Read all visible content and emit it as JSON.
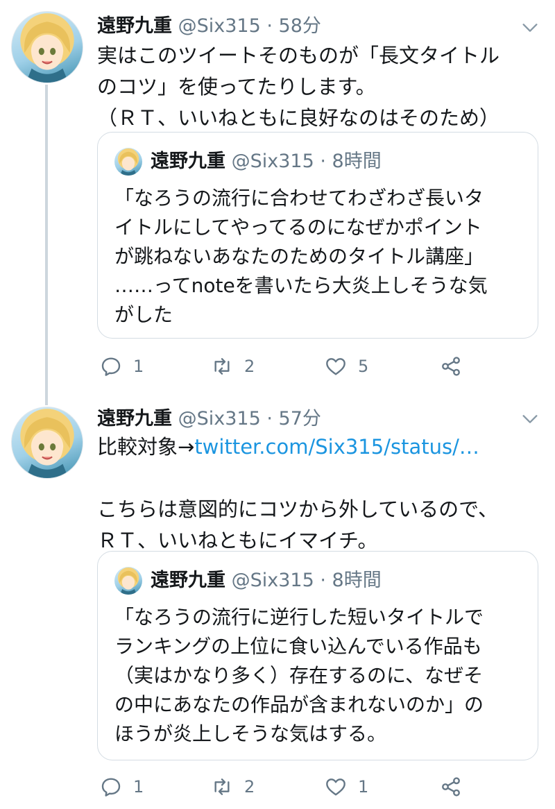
{
  "tweets": [
    {
      "name": "遠野九重",
      "handle": "@Six315",
      "sep": "·",
      "time": "58分",
      "text": "実はこのツイートそのものが「長文タイトル\nのコツ」を使ってたりします。\n（ＲＴ、いいねともに良好なのはそのため）",
      "quote": {
        "name": "遠野九重",
        "handle": "@Six315",
        "sep": "·",
        "time": "8時間",
        "text": "「なろうの流行に合わせてわざわざ長いタ\nイトルにしてやってるのになぜかポイント\nが跳ねないあなたのためのタイトル講座」\n……ってnoteを書いたら大炎上しそうな気\nがした"
      },
      "replies": "1",
      "retweets": "2",
      "likes": "5"
    },
    {
      "name": "遠野九重",
      "handle": "@Six315",
      "sep": "·",
      "time": "57分",
      "text_prefix": "比較対象→",
      "link": "twitter.com/Six315/status/…",
      "text": "\nこちらは意図的にコツから外しているので、\nＲＴ、いいねともにイマイチ。",
      "quote": {
        "name": "遠野九重",
        "handle": "@Six315",
        "sep": "·",
        "time": "8時間",
        "text": "「なろうの流行に逆行した短いタイトルで\nランキングの上位に食い込んでいる作品も\n（実はかなり多く）存在するのに、なぜそ\nの中にあなたの作品が含まれないのか」の\nほうが炎上しそうな気はする。"
      },
      "replies": "1",
      "retweets": "2",
      "likes": "1"
    }
  ],
  "colors": {
    "link": "#1b95e0",
    "muted": "#657786",
    "border": "#d4dce3",
    "thread": "#cdd6dd"
  },
  "icons": [
    "chevron-down-icon",
    "reply-icon",
    "retweet-icon",
    "like-icon",
    "share-icon"
  ]
}
